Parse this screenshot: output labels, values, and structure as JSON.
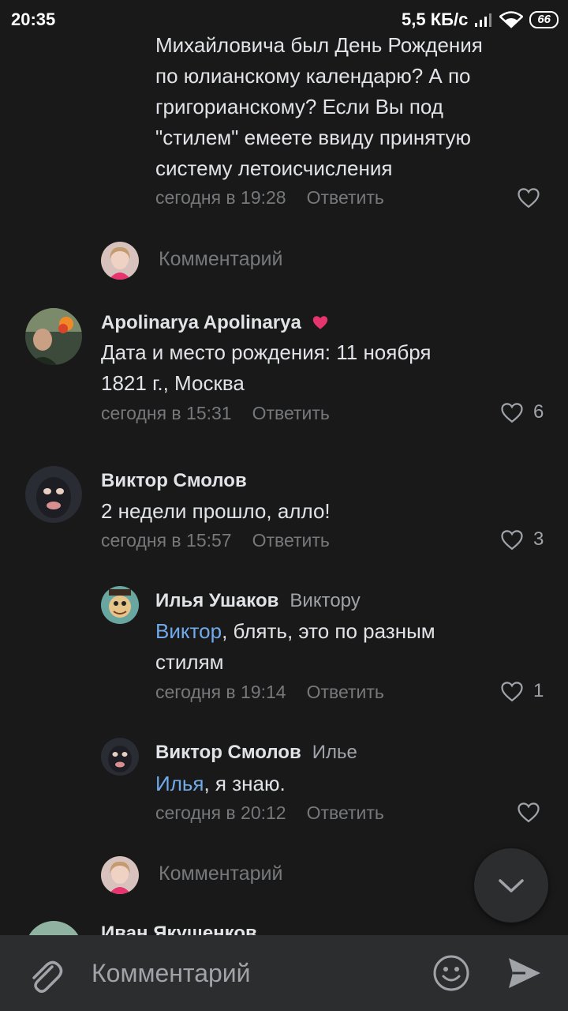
{
  "status_bar": {
    "time": "20:35",
    "network_speed": "5,5 КБ/с",
    "battery": "66"
  },
  "thread": [
    {
      "id": "partial",
      "text": "Михайловича был День Рождения по юлианскому календарю? А по григорианскому? Если Вы под \"стилем\" емеете ввиду принятую систему летоисчисления",
      "lines": [
        "Михайловича был День Рождения",
        "по юлианскому календарю? А по",
        "григорианскому? Если Вы под",
        "\"стилем\" емеете ввиду принятую",
        "системy летоисчисления"
      ],
      "time": "сегодня в 19:28",
      "reply": "Ответить"
    },
    {
      "id": "apolinarya",
      "author": "Apolinarya Apolinarya",
      "text_line1": "Дата и место рождения: 11 ноября",
      "text_line2": "1821 г., Москва",
      "time": "сегодня в 15:31",
      "reply": "Ответить",
      "likes": "6"
    },
    {
      "id": "viktor1",
      "author": "Виктор Смолов",
      "text": "2 недели прошло, алло!",
      "time": "сегодня в 15:57",
      "reply": "Ответить",
      "likes": "3"
    },
    {
      "id": "ilya",
      "author": "Илья Ушаков",
      "to": "Виктору",
      "mention": "Виктор",
      "text_rest": ", блять, это по разным",
      "text_line2": "стилям",
      "time": "сегодня в 19:14",
      "reply": "Ответить",
      "likes": "1"
    },
    {
      "id": "viktor2",
      "author": "Виктор Смолов",
      "to": "Илье",
      "mention": "Илья",
      "text_rest": ", я знаю.",
      "time": "сегодня в 20:12",
      "reply": "Ответить"
    }
  ],
  "comment_placeholder": "Комментарий",
  "partial_author": "Иван Якушенков",
  "input": {
    "placeholder": "Комментарий"
  },
  "colors": {
    "background": "#19191a",
    "link": "#71aaeb",
    "heart": "#e64646",
    "bar": "#2c2d2e"
  }
}
